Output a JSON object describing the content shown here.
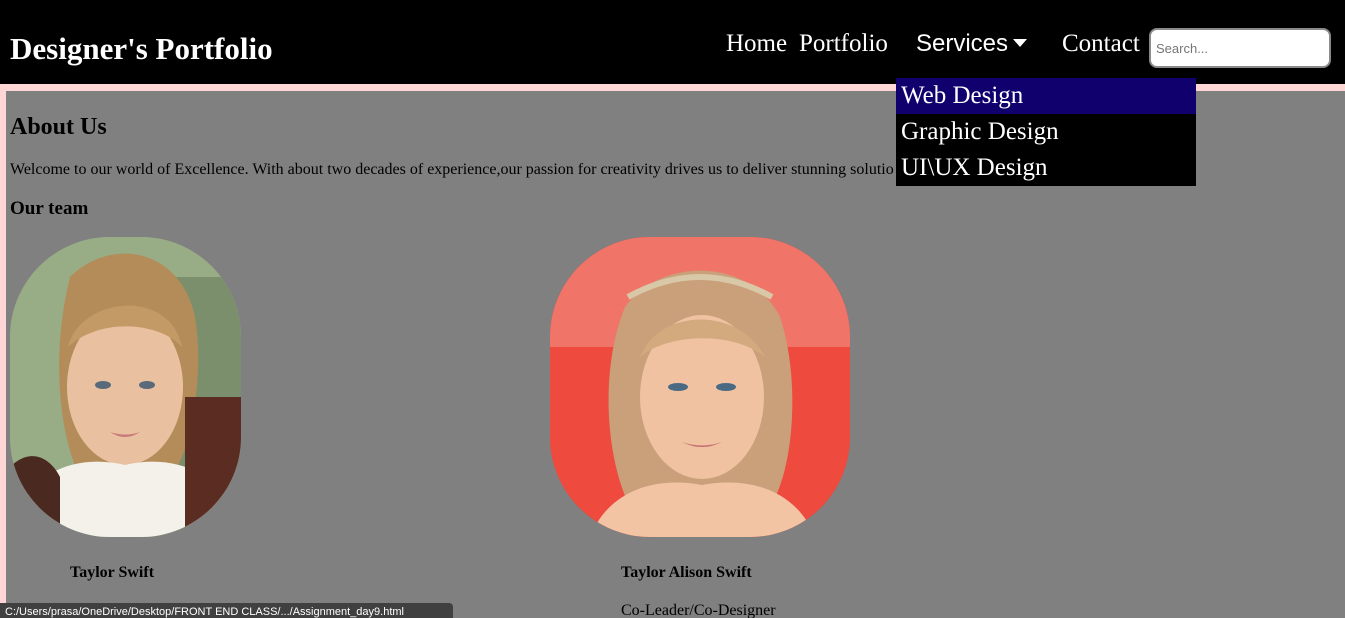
{
  "header": {
    "brand": "Designer's Portfolio",
    "nav": {
      "home": "Home",
      "portfolio": "Portfolio",
      "services": "Services",
      "contact": "Contact"
    },
    "search": {
      "placeholder": "Search...",
      "value": ""
    }
  },
  "services_dropdown": {
    "items": [
      "Web Design",
      "Graphic Design",
      "UI\\UX Design"
    ],
    "highlighted": "Web Design"
  },
  "about": {
    "title": "About Us",
    "text": "Welcome to our world of Excellence. With about two decades of experience,our passion for creativity drives us to deliver stunning solutio",
    "team_title": "Our team"
  },
  "team": [
    {
      "name": "Taylor Swift",
      "role": ""
    },
    {
      "name": "Taylor Alison Swift",
      "role": "Co-Leader/Co-Designer"
    }
  ],
  "status_bar": {
    "url": "C:/Users/prasa/OneDrive/Desktop/FRONT END CLASS/.../Assignment_day9.html"
  },
  "colors": {
    "navbar_bg": "#000000",
    "page_border": "#ffd6d6",
    "content_bg": "#808080",
    "dropdown_bg": "#000000",
    "dropdown_active": "#10006e",
    "text_light": "#ffffff"
  },
  "icons": {
    "services_caret": "caret-down-icon"
  }
}
